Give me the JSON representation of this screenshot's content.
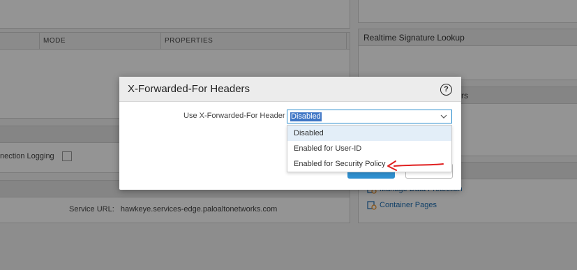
{
  "background": {
    "table_columns": [
      "MODE",
      "PROPERTIES"
    ],
    "realtime_signature_lookup": "Realtime Signature Lookup",
    "right_panel2_partial_header": "rs",
    "connection_logging_label": "nection Logging",
    "service_url_label": "Service URL:",
    "service_url_value": "hawkeye.services-edge.paloaltonetworks.com",
    "links": [
      "Manage Data Protection",
      "Container Pages"
    ]
  },
  "modal": {
    "title": "X-Forwarded-For Headers",
    "help_symbol": "?",
    "field_label": "Use X-Forwarded-For Header",
    "selected_value": "Disabled",
    "options": [
      "Disabled",
      "Enabled for User-ID",
      "Enabled for Security Policy"
    ]
  },
  "colors": {
    "accent": "#2f8fcf",
    "selection": "#3f76c5",
    "annotation": "#e02020"
  }
}
